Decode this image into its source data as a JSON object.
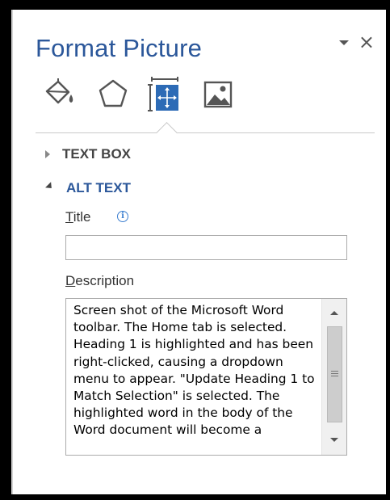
{
  "pane": {
    "title": "Format Picture"
  },
  "tabs": [
    {
      "icon": "fill-line-icon"
    },
    {
      "icon": "effects-icon"
    },
    {
      "icon": "size-properties-icon",
      "selected": true
    },
    {
      "icon": "picture-icon"
    }
  ],
  "sections": {
    "text_box": {
      "label": "TEXT BOX",
      "expanded": false
    },
    "alt_text": {
      "label": "ALT TEXT",
      "expanded": true
    }
  },
  "alt_text": {
    "title_label_underlined": "T",
    "title_label_rest": "itle",
    "title_value": "",
    "description_label_underlined": "D",
    "description_label_rest": "escription",
    "description_value": "Screen shot of the Microsoft Word toolbar.  The Home tab is selected.  Heading 1 is highlighted and has been right-clicked, causing a dropdown menu to appear.  \"Update Heading 1 to Match Selection\" is selected.  The highlighted word in the body of the Word document will become a"
  },
  "colors": {
    "title": "#2b579a",
    "accent": "#2b579a",
    "section_collapsed": "#444444"
  }
}
